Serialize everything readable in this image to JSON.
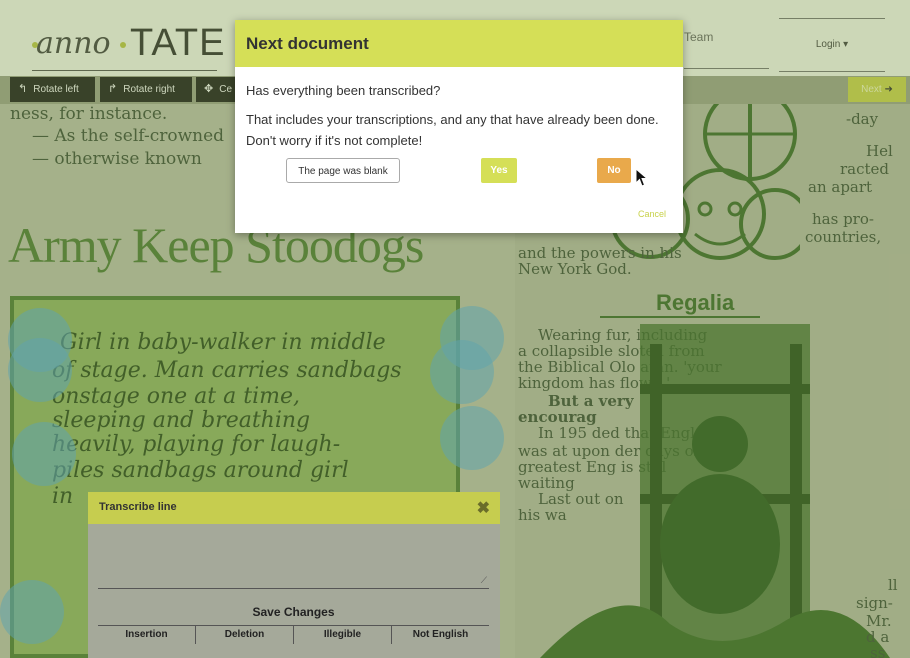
{
  "header": {
    "logo_anno": "anno",
    "logo_tate": "TATE",
    "nav_team": "Team",
    "login_label": "Login ▾"
  },
  "toolbar": {
    "rotate_left": "Rotate left",
    "rotate_right": "Rotate right",
    "center": "Ce",
    "next": "Next"
  },
  "document": {
    "print_lines_top": [
      "ness, for instance.",
      "— As the self-crowned",
      "— otherwise known"
    ],
    "headline": "Army Keep Stoodogs",
    "handwriting": [
      "Girl in baby-walker in middle",
      "of stage. Man carries sandbags",
      "onstage one at a time,",
      "sleeping and breathing",
      "heavily, playing for laugh-",
      "piles sandbags around girl",
      "in"
    ],
    "right_col_top": [
      "-day",
      "Hel",
      "racted",
      "an apart",
      "has pro-",
      "countries,",
      "and the powers in his",
      "New York  God."
    ],
    "regalia_title": "Regalia",
    "regalia_lines": [
      "Wearing fur, including",
      "a collapsible  sloted from",
      "the Biblical  Olo atan. 'your",
      "kingdom has flown.'",
      "But  a  very",
      "encourag",
      "In 195  ded  that  England",
      "was at  upon  der days of",
      "greatest  Eng  is still",
      "waiting",
      "Last  out on",
      "his wa"
    ],
    "right_col_bottom": [
      "ll",
      "sign-",
      "Mr.",
      "d a",
      "ss"
    ]
  },
  "transcribe_panel": {
    "title": "Transcribe line",
    "close": "✖",
    "textarea_value": "",
    "save_label": "Save Changes",
    "tools": [
      "Insertion",
      "Deletion",
      "Illegible",
      "Not English"
    ]
  },
  "modal": {
    "title": "Next document",
    "question": "Has everything been transcribed?",
    "paragraph": "That includes your transcriptions, and any that have already been done. Don't worry if it's not complete!",
    "blank_label": "The page was blank",
    "yes_label": "Yes",
    "no_label": "No",
    "cancel_label": "Cancel"
  },
  "colors": {
    "accent": "#d5df57",
    "no_button": "#e9a94b",
    "marker": "#5aaad7",
    "toolbar": "#222222"
  }
}
